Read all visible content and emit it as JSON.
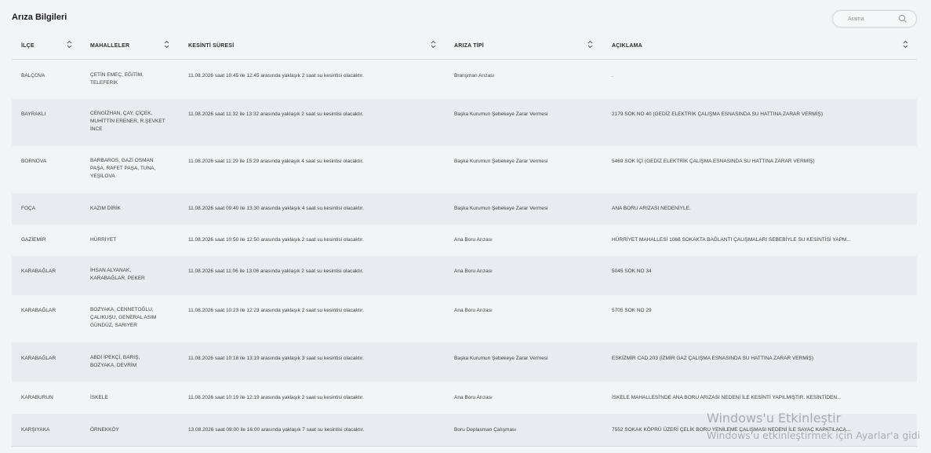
{
  "page": {
    "title": "Arıza Bilgileri"
  },
  "search": {
    "placeholder": "Arama",
    "icon": "search-icon"
  },
  "table": {
    "columns": [
      {
        "key": "ilce",
        "label": "İLÇE"
      },
      {
        "key": "mahalleler",
        "label": "MAHALLELER"
      },
      {
        "key": "kesinti",
        "label": "KESİNTİ SÜRESİ"
      },
      {
        "key": "tip",
        "label": "ARIZA TİPİ"
      },
      {
        "key": "aciklama",
        "label": "AÇIKLAMA"
      }
    ],
    "rows": [
      {
        "ilce": "BALÇOVA",
        "mahalleler": [
          "ÇETİN EMEÇ, EĞİTİM,",
          "TELEFERİK"
        ],
        "kesinti": "11.08.2026 saat 10:45 ile 12:45 arasında yaklaşık 2 saat su kesintisi olacaktır.",
        "tip": "Branşman Arızası",
        "aciklama": "."
      },
      {
        "ilce": "BAYRAKLI",
        "mahalleler": [
          "CENGİZHAN, ÇAY, ÇİÇEK,",
          "MUHİTTİN ERENER, R.ŞEVKET",
          "İNCE"
        ],
        "kesinti": "11.08.2026 saat 11:32 ile 13:32 arasında yaklaşık 2 saat su kesintisi olacaktır.",
        "tip": "Başka Kurumun Şebekeye Zarar Vermesi",
        "aciklama": "2179 SOK NO 40 (GEDİZ ELEKTRİK ÇALIŞMA ESNASINDA SU HATTINA ZARAR VERMİŞ)"
      },
      {
        "ilce": "BORNOVA",
        "mahalleler": [
          "BARBAROS, GAZİ OSMAN",
          "PAŞA, RAFET PAŞA, TUNA,",
          "YEŞİLOVA"
        ],
        "kesinti": "11.08.2026 saat 11:29 ile 15:29 arasında yaklaşık 4 saat su kesintisi olacaktır.",
        "tip": "Başka Kurumun Şebekeye Zarar Vermesi",
        "aciklama": "5469 SOK İÇİ (GEDİZ ELEKTRİK ÇALIŞMA ESNASINDA SU HATTINA ZARAR VERMİŞ)"
      },
      {
        "ilce": "FOÇA",
        "mahalleler": [
          "KAZIM DİRİK"
        ],
        "kesinti": "11.08.2026 saat 09:40 ile 13:30 arasında yaklaşık 4 saat su kesintisi olacaktır.",
        "tip": "Başka Kurumun Şebekeye Zarar Vermesi",
        "aciklama": "ANA BORU ARIZASI NEDENİYLE."
      },
      {
        "ilce": "GAZİEMİR",
        "mahalleler": [
          "HÜRRİYET"
        ],
        "kesinti": "11.08.2026 saat 10:50 ile 12:50 arasında yaklaşık 2 saat su kesintisi olacaktır.",
        "tip": "Ana Boru Arızası",
        "aciklama": "HÜRRİYET MAHALLESİ 1068 SOKAKTA BAĞLANTI ÇALIŞMALARI SEBEBİYLE SU KESİNTİSİ YAPM..."
      },
      {
        "ilce": "KARABAĞLAR",
        "mahalleler": [
          "İHSAN ALYANAK,",
          "KARABAĞLAR, PEKER"
        ],
        "kesinti": "11.08.2026 saat 11:06 ile 13:06 arasında yaklaşık 2 saat su kesintisi olacaktır.",
        "tip": "Ana Boru Arızası",
        "aciklama": "5045 SOK NO 34"
      },
      {
        "ilce": "KARABAĞLAR",
        "mahalleler": [
          "BOZYAKA, CENNETOĞLU,",
          "ÇALIKUŞU, GENERAL ASIM",
          "GÜNDÜZ, SARIYER"
        ],
        "kesinti": "11.08.2026 saat 10:23 ile 12:23 arasında yaklaşık 2 saat su kesintisi olacaktır.",
        "tip": "Ana Boru Arızası",
        "aciklama": "5705 SOK NO 29"
      },
      {
        "ilce": "KARABAĞLAR",
        "mahalleler": [
          "ABDİ İPEKÇİ, BARIŞ,",
          "BOZYAKA, DEVRİM"
        ],
        "kesinti": "11.08.2026 saat 10:18 ile 13:19 arasında yaklaşık 3 saat su kesintisi olacaktır.",
        "tip": "Başka Kurumun Şebekeye Zarar Vermesi",
        "aciklama": "ESKİZMİR CAD.203 (İZMİR GAZ ÇALIŞMA ESNASINDA SU HATTINA ZARAR VERMİŞ)"
      },
      {
        "ilce": "KARABURUN",
        "mahalleler": [
          "İSKELE"
        ],
        "kesinti": "11.08.2026 saat 10:19 ile 12:19 arasında yaklaşık 2 saat su kesintisi olacaktır.",
        "tip": "Ana Boru Arızası",
        "aciklama": "İSKELE MAHALLESİ'NDE ANA BORU ARIZASI NEDENİ İLE KESİNTİ YAPILMIŞTIR. KESİNTİDEN..."
      },
      {
        "ilce": "KARŞIYAKA",
        "mahalleler": [
          "ÖRNEKKÖY"
        ],
        "kesinti": "13.08.2026 saat 09:00 ile 16:00 arasında yaklaşık 7 saat su kesintisi olacaktır.",
        "tip": "Boru Deplasman Çalışması",
        "aciklama": "7552 SOKAK KÖPRÜ ÜZERİ ÇELİK BORU YENİLEME ÇALIŞMASI NEDENİ İLE SAYAÇ KAPATILACA..."
      }
    ]
  },
  "watermark": {
    "line1": "Windows'u Etkinleştir",
    "line2": "Windows'u etkinleştirmek için Ayarlar'a gidi"
  },
  "colors": {
    "background": "#f3f4f7",
    "row_alt": "#e8ebf0",
    "header_text": "#2d2d2d",
    "divider": "#d6d9df"
  }
}
